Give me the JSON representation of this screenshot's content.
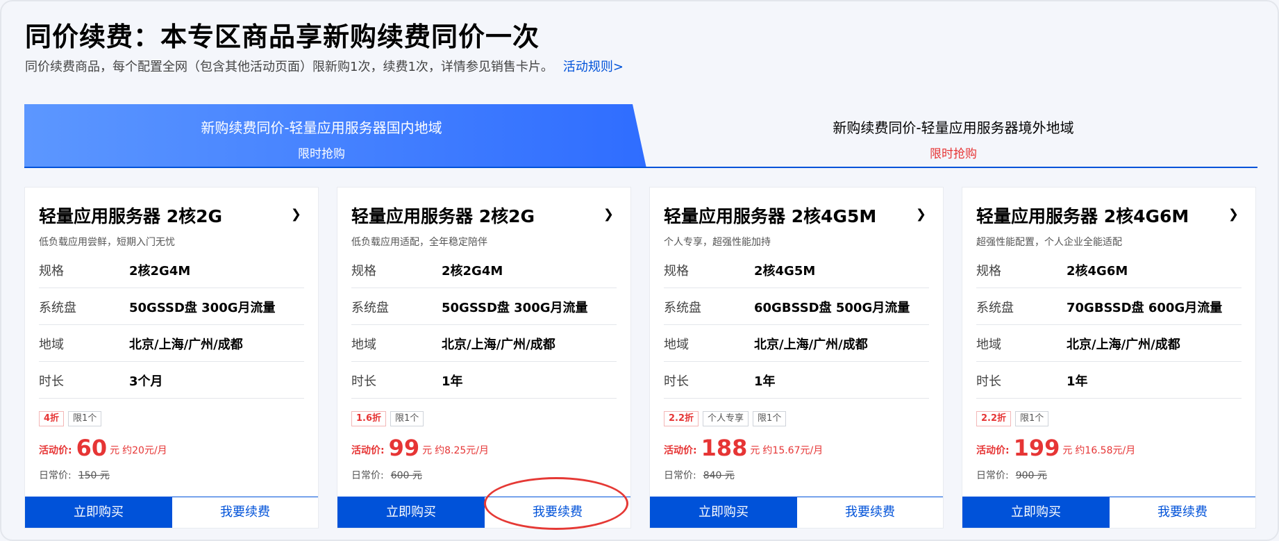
{
  "header": {
    "title": "同价续费：本专区商品享新购续费同价一次",
    "subtitle": "同价续费商品，每个配置全网（包含其他活动页面）限新购1次，续费1次，详情参见销售卡片。",
    "rules_link": "活动规则>"
  },
  "tabs": [
    {
      "title": "新购续费同价-轻量应用服务器国内地域",
      "sub": "限时抢购",
      "active": true
    },
    {
      "title": "新购续费同价-轻量应用服务器境外地域",
      "sub": "限时抢购",
      "active": false
    }
  ],
  "cards": [
    {
      "name": "轻量应用服务器 2核2G",
      "desc": "低负载应用尝鲜，短期入门无忧",
      "specs": [
        {
          "label": "规格",
          "value": "2核2G4M"
        },
        {
          "label": "系统盘",
          "value": "50GSSD盘 300G月流量"
        },
        {
          "label": "地域",
          "value": "北京/上海/广州/成都"
        },
        {
          "label": "时长",
          "value": "3个月"
        }
      ],
      "tags": [
        "4折",
        "限1个"
      ],
      "price_label": "活动价:",
      "price": "60",
      "unit": "元",
      "monthly": "约20元/月",
      "orig_label": "日常价:",
      "orig_value": "150 元",
      "buy": "立即购买",
      "renew": "我要续费"
    },
    {
      "name": "轻量应用服务器 2核2G",
      "desc": "低负载应用适配，全年稳定陪伴",
      "specs": [
        {
          "label": "规格",
          "value": "2核2G4M"
        },
        {
          "label": "系统盘",
          "value": "50GSSD盘 300G月流量"
        },
        {
          "label": "地域",
          "value": "北京/上海/广州/成都"
        },
        {
          "label": "时长",
          "value": "1年"
        }
      ],
      "tags": [
        "1.6折",
        "限1个"
      ],
      "price_label": "活动价:",
      "price": "99",
      "unit": "元",
      "monthly": "约8.25元/月",
      "orig_label": "日常价:",
      "orig_value": "600 元",
      "buy": "立即购买",
      "renew": "我要续费"
    },
    {
      "name": "轻量应用服务器 2核4G5M",
      "desc": "个人专享，超强性能加持",
      "specs": [
        {
          "label": "规格",
          "value": "2核4G5M"
        },
        {
          "label": "系统盘",
          "value": "60GBSSD盘 500G月流量"
        },
        {
          "label": "地域",
          "value": "北京/上海/广州/成都"
        },
        {
          "label": "时长",
          "value": "1年"
        }
      ],
      "tags": [
        "2.2折",
        "个人专享",
        "限1个"
      ],
      "price_label": "活动价:",
      "price": "188",
      "unit": "元",
      "monthly": "约15.67元/月",
      "orig_label": "日常价:",
      "orig_value": "840 元",
      "buy": "立即购买",
      "renew": "我要续费"
    },
    {
      "name": "轻量应用服务器 2核4G6M",
      "desc": "超强性能配置，个人企业全能适配",
      "specs": [
        {
          "label": "规格",
          "value": "2核4G6M"
        },
        {
          "label": "系统盘",
          "value": "70GBSSD盘 600G月流量"
        },
        {
          "label": "地域",
          "value": "北京/上海/广州/成都"
        },
        {
          "label": "时长",
          "value": "1年"
        }
      ],
      "tags": [
        "2.2折",
        "限1个"
      ],
      "price_label": "活动价:",
      "price": "199",
      "unit": "元",
      "monthly": "约16.58元/月",
      "orig_label": "日常价:",
      "orig_value": "900 元",
      "buy": "立即购买",
      "renew": "我要续费"
    }
  ],
  "colors": {
    "accent": "#0052d9",
    "price": "#e63535",
    "highlight": "#e53935"
  },
  "icons": {
    "card_more": "chevron-right-icon"
  }
}
